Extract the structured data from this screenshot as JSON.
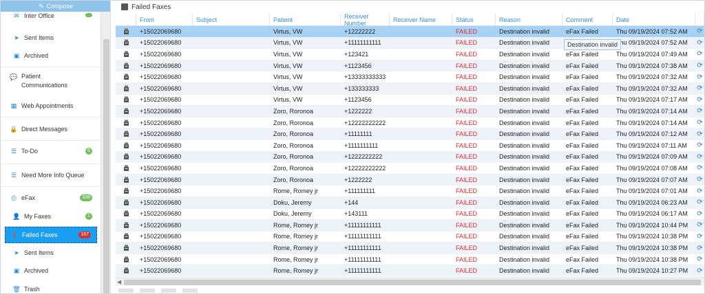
{
  "sidebar": {
    "compose_label": "Compose",
    "items": [
      {
        "label": "Inter Office",
        "icon": "envelope-icon",
        "badge": ""
      },
      {
        "label": "Sent Items",
        "icon": "paper-plane-icon"
      },
      {
        "label": "Archived",
        "icon": "archive-icon"
      },
      {
        "label": "Patient Communications",
        "icon": "chat-icon"
      },
      {
        "label": "Web Appointments",
        "icon": "calendar-icon"
      },
      {
        "label": "Direct Messages",
        "icon": "lock-icon"
      },
      {
        "label": "To-Do",
        "icon": "list-icon",
        "badge": "6"
      },
      {
        "label": "Need More Info Queue",
        "icon": "list-icon"
      },
      {
        "label": "eFax",
        "icon": "fax-icon",
        "badge": "338"
      },
      {
        "label": "My Faxes",
        "icon": "user-icon",
        "badge": "1"
      },
      {
        "label": "Failed Faxes",
        "icon": "alert-icon",
        "badge": "167"
      },
      {
        "label": "Sent Items",
        "icon": "paper-plane-icon"
      },
      {
        "label": "Archived",
        "icon": "archive-icon"
      },
      {
        "label": "Trash",
        "icon": "trash-icon"
      }
    ]
  },
  "main": {
    "title": "Failed Faxes",
    "columns": [
      "From",
      "Subject",
      "Patient",
      "Receiver Number",
      "Receiver Name",
      "Status",
      "Reason",
      "Comment",
      "Date"
    ],
    "tooltip": "Destination invalid",
    "rows": [
      {
        "from": "+15022069680",
        "subject": "",
        "patient": "Virtus, VW",
        "receiver_number": "+12222222",
        "receiver_name": "",
        "status": "FAILED",
        "reason": "Destination invalid",
        "comment": "eFax Failed",
        "date": "Thu 09/19/2024 07:52 AM"
      },
      {
        "from": "+15022069680",
        "subject": "",
        "patient": "Virtus, VW",
        "receiver_number": "+11111111111",
        "receiver_name": "",
        "status": "FAILED",
        "reason": "Destination invalid",
        "comment": "",
        "date": "Thu 09/19/2024 07:52 AM"
      },
      {
        "from": "+15022069680",
        "subject": "",
        "patient": "Virtus, VW",
        "receiver_number": "+123421",
        "receiver_name": "",
        "status": "FAILED",
        "reason": "Destination invalid",
        "comment": "eFax Failed",
        "date": "Thu 09/19/2024 07:49 AM"
      },
      {
        "from": "+15022069680",
        "subject": "",
        "patient": "Virtus, VW",
        "receiver_number": "+1123456",
        "receiver_name": "",
        "status": "FAILED",
        "reason": "Destination invalid",
        "comment": "eFax Failed",
        "date": "Thu 09/19/2024 07:38 AM"
      },
      {
        "from": "+15022069680",
        "subject": "",
        "patient": "Virtus, VW",
        "receiver_number": "+13333333333",
        "receiver_name": "",
        "status": "FAILED",
        "reason": "Destination invalid",
        "comment": "eFax Failed",
        "date": "Thu 09/19/2024 07:32 AM"
      },
      {
        "from": "+15022069680",
        "subject": "",
        "patient": "Virtus, VW",
        "receiver_number": "+133333333",
        "receiver_name": "",
        "status": "FAILED",
        "reason": "Destination invalid",
        "comment": "eFax Failed",
        "date": "Thu 09/19/2024 07:32 AM"
      },
      {
        "from": "+15022069680",
        "subject": "",
        "patient": "Virtus, VW",
        "receiver_number": "+1123456",
        "receiver_name": "",
        "status": "FAILED",
        "reason": "Destination invalid",
        "comment": "eFax Failed",
        "date": "Thu 09/19/2024 07:17 AM"
      },
      {
        "from": "+15022069680",
        "subject": "",
        "patient": "Zoro, Roronoa",
        "receiver_number": "+1222222",
        "receiver_name": "",
        "status": "FAILED",
        "reason": "Destination invalid",
        "comment": "eFax Failed",
        "date": "Thu 09/19/2024 07:14 AM"
      },
      {
        "from": "+15022069680",
        "subject": "",
        "patient": "Zoro, Roronoa",
        "receiver_number": "+12222222222",
        "receiver_name": "",
        "status": "FAILED",
        "reason": "Destination invalid",
        "comment": "eFax Failed",
        "date": "Thu 09/19/2024 07:14 AM"
      },
      {
        "from": "+15022069680",
        "subject": "",
        "patient": "Zoro, Roronoa",
        "receiver_number": "+11111111",
        "receiver_name": "",
        "status": "FAILED",
        "reason": "Destination invalid",
        "comment": "eFax Failed",
        "date": "Thu 09/19/2024 07:12 AM"
      },
      {
        "from": "+15022069680",
        "subject": "",
        "patient": "Zoro, Roronoa",
        "receiver_number": "+1111111111",
        "receiver_name": "",
        "status": "FAILED",
        "reason": "Destination invalid",
        "comment": "eFax Failed",
        "date": "Thu 09/19/2024 07:11 AM"
      },
      {
        "from": "+15022069680",
        "subject": "",
        "patient": "Zoro, Roronoa",
        "receiver_number": "+1222222222",
        "receiver_name": "",
        "status": "FAILED",
        "reason": "Destination invalid",
        "comment": "eFax Failed",
        "date": "Thu 09/19/2024 07:09 AM"
      },
      {
        "from": "+15022069680",
        "subject": "",
        "patient": "Zoro, Roronoa",
        "receiver_number": "+12222222222",
        "receiver_name": "",
        "status": "FAILED",
        "reason": "Destination invalid",
        "comment": "eFax Failed",
        "date": "Thu 09/19/2024 07:08 AM"
      },
      {
        "from": "+15022069680",
        "subject": "",
        "patient": "Zoro, Roronoa",
        "receiver_number": "+1222222",
        "receiver_name": "",
        "status": "FAILED",
        "reason": "Destination invalid",
        "comment": "eFax Failed",
        "date": "Thu 09/19/2024 07:07 AM"
      },
      {
        "from": "+15022069680",
        "subject": "",
        "patient": "Rome, Romey jr",
        "receiver_number": "+111111111",
        "receiver_name": "",
        "status": "FAILED",
        "reason": "Destination invalid",
        "comment": "eFax Failed",
        "date": "Thu 09/19/2024 07:01 AM"
      },
      {
        "from": "+15022069680",
        "subject": "",
        "patient": "Doku, Jeremy",
        "receiver_number": "+144",
        "receiver_name": "",
        "status": "FAILED",
        "reason": "Destination invalid",
        "comment": "eFax Failed",
        "date": "Thu 09/19/2024 06:23 AM"
      },
      {
        "from": "+15022069680",
        "subject": "",
        "patient": "Doku, Jeremy",
        "receiver_number": "+143111",
        "receiver_name": "",
        "status": "FAILED",
        "reason": "Destination invalid",
        "comment": "eFax Failed",
        "date": "Thu 09/19/2024 06:17 AM"
      },
      {
        "from": "+15022069680",
        "subject": "",
        "patient": "Rome, Romey jr",
        "receiver_number": "+11111111111",
        "receiver_name": "",
        "status": "FAILED",
        "reason": "Destination invalid",
        "comment": "eFax Failed",
        "date": "Thu 09/19/2024 10:44 PM"
      },
      {
        "from": "+15022069680",
        "subject": "",
        "patient": "Rome, Romey jr",
        "receiver_number": "+11111111111",
        "receiver_name": "",
        "status": "FAILED",
        "reason": "Destination invalid",
        "comment": "eFax Failed",
        "date": "Thu 09/19/2024 10:38 PM"
      },
      {
        "from": "+15022069680",
        "subject": "",
        "patient": "Rome, Romey jr",
        "receiver_number": "+11111111111",
        "receiver_name": "",
        "status": "FAILED",
        "reason": "Destination invalid",
        "comment": "eFax Failed",
        "date": "Thu 09/19/2024 10:38 PM"
      },
      {
        "from": "+15022069680",
        "subject": "",
        "patient": "Rome, Romey jr",
        "receiver_number": "+11111111111",
        "receiver_name": "",
        "status": "FAILED",
        "reason": "Destination invalid",
        "comment": "eFax Failed",
        "date": "Thu 09/19/2024 10:38 PM"
      },
      {
        "from": "+15022069680",
        "subject": "",
        "patient": "Rome, Romey jr",
        "receiver_number": "+11111111111",
        "receiver_name": "",
        "status": "FAILED",
        "reason": "Destination invalid",
        "comment": "eFax Failed",
        "date": "Thu 09/19/2024 10:27 PM"
      }
    ]
  },
  "colors": {
    "accent": "#1a9ff0",
    "failed": "#e0262d",
    "selected_row": "#a8d2f5",
    "compose": "#8ec3ec"
  }
}
